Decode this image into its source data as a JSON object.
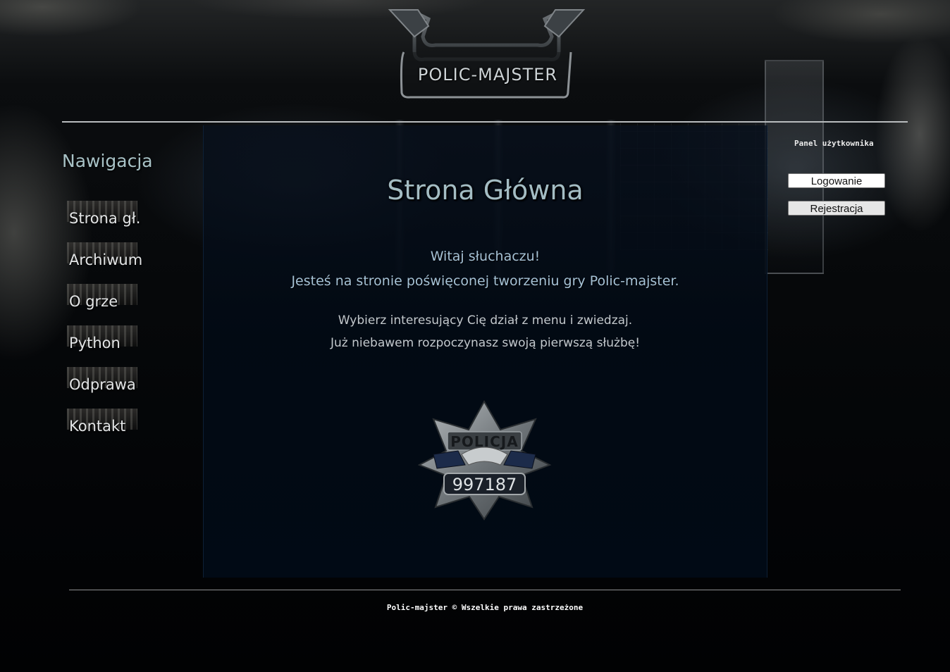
{
  "header": {
    "logo_text": "POLIC-MAJSTER"
  },
  "nav": {
    "title": "Nawigacja",
    "items": [
      {
        "label": "Strona gł."
      },
      {
        "label": "Archiwum"
      },
      {
        "label": "O grze"
      },
      {
        "label": "Python"
      },
      {
        "label": "Odprawa"
      },
      {
        "label": "Kontakt"
      }
    ]
  },
  "main": {
    "title": "Strona Główna",
    "welcome_line1": "Witaj słuchaczu!",
    "welcome_line2": "Jesteś na stronie poświęconej tworzeniu gry Polic-majster.",
    "text_line1": "Wybierz interesujący Cię dział z menu i zwiedzaj.",
    "text_line2": "Już niebawem rozpoczynasz swoją pierwszą służbę!",
    "badge": {
      "label": "POLICJA",
      "number": "997187"
    }
  },
  "user_panel": {
    "title": "Panel użytkownika",
    "login_label": "Logowanie",
    "register_label": "Rejestracja"
  },
  "footer": {
    "text": "Polic-majster © Wszelkie prawa zastrzeżone"
  },
  "colors": {
    "accent_title": "#a4bdc4",
    "welcome_text": "#a6c2d6",
    "panel_bg": "#010a15"
  }
}
